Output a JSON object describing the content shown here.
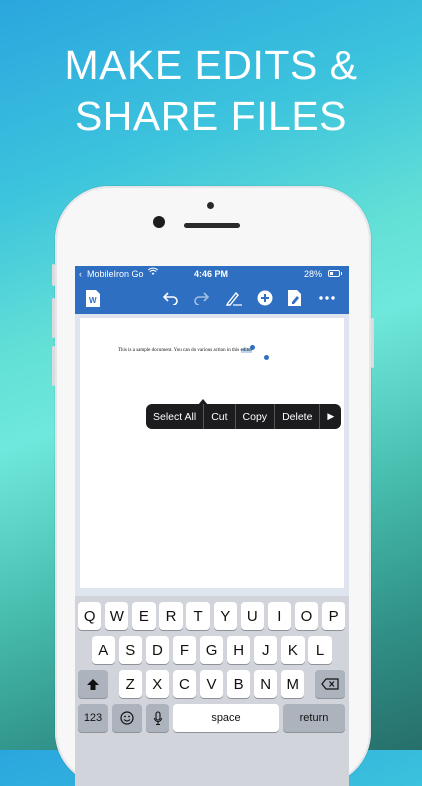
{
  "headline": {
    "line1": "MAKE EDITS &",
    "line2": "SHARE FILES"
  },
  "status_bar": {
    "carrier": "MobileIron Go",
    "time": "4:46 PM",
    "battery": "28%"
  },
  "toolbar": {
    "icons": [
      "word-doc-icon",
      "undo-icon",
      "redo-icon",
      "pen-icon",
      "add-icon",
      "edit-doc-icon",
      "more-icon"
    ]
  },
  "document": {
    "text_before": "This is a sample document. You can do various action in this",
    "selected": "editor"
  },
  "context_menu": {
    "select_all": "Select All",
    "cut": "Cut",
    "copy": "Copy",
    "delete": "Delete",
    "more": "▶"
  },
  "keyboard": {
    "row1": [
      "Q",
      "W",
      "E",
      "R",
      "T",
      "Y",
      "U",
      "I",
      "O",
      "P"
    ],
    "row2": [
      "A",
      "S",
      "D",
      "F",
      "G",
      "H",
      "J",
      "K",
      "L"
    ],
    "row3": [
      "Z",
      "X",
      "C",
      "V",
      "B",
      "N",
      "M"
    ],
    "numbers_key": "123",
    "space_key": "space",
    "return_key": "return"
  },
  "colors": {
    "app_blue": "#2f6fc1",
    "menu_dark": "#1c1c1e"
  }
}
